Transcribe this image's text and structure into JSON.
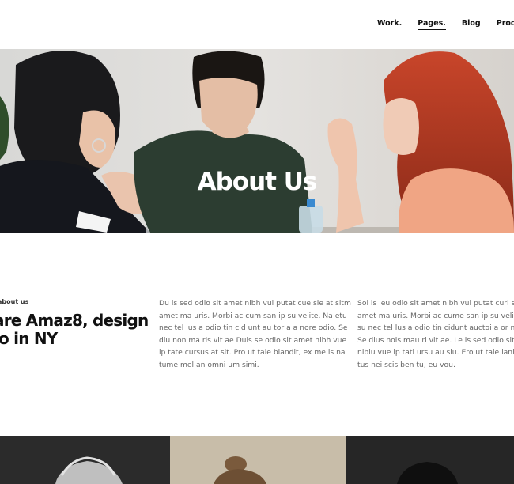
{
  "nav": {
    "items": [
      "Work.",
      "Pages.",
      "Blog",
      "Products"
    ],
    "active": "Pages."
  },
  "hero": {
    "title": "About Us"
  },
  "about": {
    "eyebrow": "about us",
    "headline_lines": [
      "are Amaz8, design",
      "io in NY"
    ],
    "paragraph1_lines": [
      "Du is sed odio sit amet nibh vul putat cue sie at sitm",
      "amet ma uris. Morbi ac cum san ip su velite. Na etu",
      "nec tel lus a odio tin cid unt au tor a a nore odio. Se",
      "diu non ma ris vit ae Duis se odio sit amet nibh vue",
      "lp tate cursus at sit. Pro ut tale blandit, ex me is na",
      "tume mel an omni um simi."
    ],
    "paragraph2_lines": [
      "Soi is leu odio sit amet nibh vul putat curi su",
      "amet ma uris. Morbi ac cume san ip su velit",
      "su nec tel lus a odio tin cidunt auctoi a or ne",
      "Se dius nois mau ri vit ae. Le is sed odio sit a",
      "nibiu vue lp tati ursu au siu. Ero ut tale lani, e",
      "tus nei scis ben tu, eu vou."
    ]
  },
  "colors": {
    "text_dark": "#111111",
    "text_muted": "#666666",
    "tile1": "#2b2b2b",
    "tile2": "#c8bda9",
    "tile3": "#262626"
  }
}
